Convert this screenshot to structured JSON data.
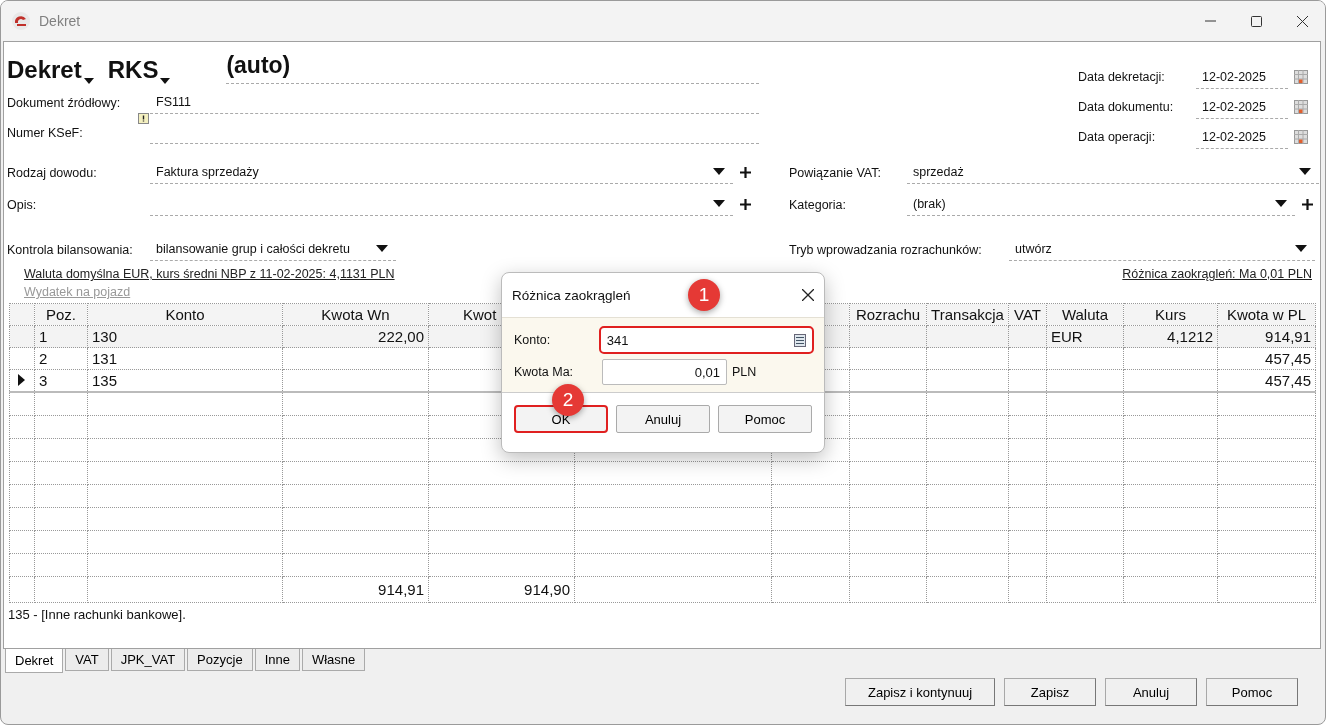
{
  "window": {
    "title": "Dekret"
  },
  "header": {
    "document_type": "Dekret",
    "register": "RKS",
    "number": "(auto)"
  },
  "source_document": {
    "label": "Dokument źródłowy:",
    "value": "FS111"
  },
  "ksef_number": {
    "label": "Numer KSeF:"
  },
  "dates": [
    {
      "label": "Data dekretacji:",
      "value": "12-02-2025"
    },
    {
      "label": "Data dokumentu:",
      "value": "12-02-2025"
    },
    {
      "label": "Data operacji:",
      "value": "12-02-2025"
    }
  ],
  "pairs": [
    {
      "left": {
        "label": "Rodzaj dowodu:",
        "value": "Faktura sprzedaży",
        "add": true
      },
      "right": {
        "label": "Powiązanie VAT:",
        "value": "sprzedaż",
        "add": false
      }
    },
    {
      "left": {
        "label": "Opis:",
        "add": true
      },
      "right": {
        "label": "Kategoria:",
        "value": "(brak)",
        "add": true
      }
    }
  ],
  "balance_control": {
    "label": "Kontrola bilansowania:",
    "value": "bilansowanie grup i całości dekretu"
  },
  "settlement_mode": {
    "label": "Tryb wprowadzania rozrachunków:",
    "value": "utwórz"
  },
  "links": {
    "currency": "Waluta domyślna EUR, kurs średni NBP z 11-02-2025: 4,1131 PLN",
    "rounding": "Różnica zaokrągleń: Ma 0,01 PLN",
    "vehicle": {
      "label": "Wydatek na pojazd",
      "disabled": true
    }
  },
  "table": {
    "columns": [
      {
        "label": "Poz.",
        "kind": "text"
      },
      {
        "label": "Konto",
        "kind": "text"
      },
      {
        "label": "Kwota Wn",
        "kind": "amount"
      },
      {
        "label": "Kwot",
        "kind": "amount"
      },
      {
        "kind": "text"
      },
      {
        "kind": "text"
      },
      {
        "label": "Rozrachu",
        "kind": "text"
      },
      {
        "label": "Transakcja",
        "kind": "text"
      },
      {
        "label": "VAT",
        "kind": "text"
      },
      {
        "label": "Waluta",
        "kind": "text"
      },
      {
        "label": "Kurs",
        "kind": "amount"
      },
      {
        "label": "Kwota w PL",
        "kind": "amount"
      }
    ],
    "rows": [
      {
        "cells": [
          "1",
          "130",
          "222,00",
          null,
          null,
          null,
          null,
          null,
          null,
          "EUR",
          "4,1212",
          "914,91"
        ],
        "selected": true,
        "current": false
      },
      {
        "cells": [
          "2",
          "131",
          null,
          null,
          null,
          null,
          null,
          null,
          null,
          null,
          null,
          "457,45"
        ],
        "selected": false,
        "current": false
      },
      {
        "cells": [
          "3",
          "135",
          null,
          null,
          null,
          null,
          null,
          null,
          null,
          null,
          null,
          "457,45"
        ],
        "selected": false,
        "current": true
      }
    ],
    "totals": {
      "debit": "914,91",
      "credit": "914,90"
    }
  },
  "status_message": "135 - [Inne rachunki bankowe].",
  "tabs": [
    {
      "label": "Dekret",
      "selected": true
    },
    {
      "label": "VAT",
      "selected": false
    },
    {
      "label": "JPK_VAT",
      "selected": false
    },
    {
      "label": "Pozycje",
      "selected": false
    },
    {
      "label": "Inne",
      "selected": false
    },
    {
      "label": "Własne",
      "selected": false
    }
  ],
  "buttons": [
    "Zapisz i kontynuuj",
    "Zapisz",
    "Anuluj",
    "Pomoc"
  ],
  "dialog": {
    "title": "Różnica zaokrągleń",
    "fields": [
      {
        "label": "Konto:",
        "value": "341",
        "kind": "lookup",
        "highlighted": true
      },
      {
        "label": "Kwota Ma:",
        "value": "0,01",
        "kind": "amount",
        "unit": "PLN",
        "highlighted": false
      }
    ],
    "buttons": [
      {
        "label": "OK",
        "highlighted": true
      },
      {
        "label": "Anuluj",
        "highlighted": false
      },
      {
        "label": "Pomoc",
        "highlighted": false
      }
    ]
  },
  "annotations": [
    {
      "text": "1"
    },
    {
      "text": "2"
    }
  ]
}
